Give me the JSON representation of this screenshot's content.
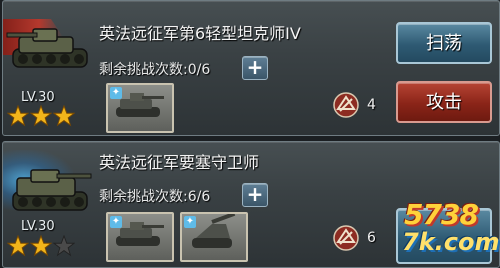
{
  "missions": [
    {
      "title": "英法远征军第6轻型坦克师IV",
      "attempts_label": "剩余挑战次数:0/6",
      "level": "LV.30",
      "stars": 3,
      "reward_count": "4",
      "buttons": {
        "sweep": "扫荡",
        "attack": "攻击"
      },
      "thumbnails": [
        "tank-thumbnail-icon"
      ],
      "highlight": "red-arrow"
    },
    {
      "title": "英法远征军要塞守卫师",
      "attempts_label": "剩余挑战次数:6/6",
      "level": "LV.30",
      "stars": 2,
      "reward_count": "6",
      "thumbnails": [
        "tank-thumbnail-icon",
        "artillery-thumbnail-icon"
      ],
      "highlight": "blue-glow"
    }
  ],
  "watermark": {
    "line1": "5738",
    "line2": "7k.com"
  },
  "colors": {
    "star_on": "#f2b51b",
    "star_off": "#4a4a4a",
    "accent_blue": "#2e5a73",
    "accent_red": "#8a2418"
  }
}
